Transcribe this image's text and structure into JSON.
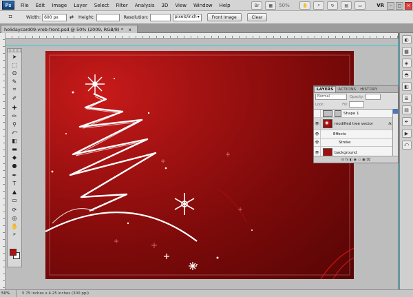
{
  "menubar": {
    "logo": "Ps",
    "items": [
      "File",
      "Edit",
      "Image",
      "Layer",
      "Select",
      "Filter",
      "Analysis",
      "3D",
      "View",
      "Window",
      "Help"
    ],
    "zoom": "50%",
    "workspace": "VR"
  },
  "options": {
    "width_label": "Width:",
    "width_value": "600 px",
    "height_label": "Height:",
    "height_value": "",
    "resolution_label": "Resolution:",
    "resolution_value": "",
    "resolution_unit": "pixels/inch",
    "front_image_button": "Front Image",
    "clear_button": "Clear"
  },
  "document": {
    "tab_title": "holidaycard09-vrob-front.psd @ 50% (2009, RGB/8) *",
    "close": "x"
  },
  "layers_panel": {
    "tabs": [
      "LAYERS",
      "ACTIONS",
      "HISTORY"
    ],
    "blend_mode": "Normal",
    "opacity_label": "Opacity:",
    "lock_label": "Lock:",
    "fill_label": "Fill:",
    "layers": [
      {
        "name": "Shape 1",
        "type": "shape",
        "visible": false
      },
      {
        "name": "modified tree vector",
        "type": "tree",
        "visible": true,
        "fx": "fx"
      },
      {
        "name": "Effects",
        "type": "sub"
      },
      {
        "name": "Stroke",
        "type": "sub"
      },
      {
        "name": "background",
        "type": "bg",
        "visible": true
      }
    ],
    "footer_icons": "⊝ fx ◐ ◉ ▭ ▣ ⌧"
  },
  "status": {
    "zoom": "50%",
    "doc_info": "5.75 inches x 4.25 inches (300 ppi)"
  },
  "colors": {
    "foreground": "#b40f0f",
    "background": "#ffffff",
    "canvas_red": "#a31212"
  }
}
